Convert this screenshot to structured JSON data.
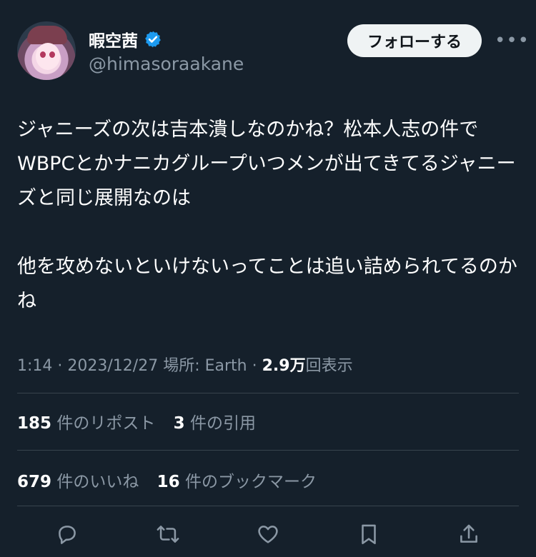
{
  "user": {
    "display_name": "暇空茜",
    "handle": "@himasoraakane",
    "verified": true
  },
  "header": {
    "follow_label": "フォローする",
    "more_label": "•••"
  },
  "tweet": {
    "text": "ジャニーズの次は吉本潰しなのかね？松本人志の件でWBPCとかナニカグループいつメンが出てきてるジャニーズと同じ展開なのは\n\n他を攻めないといけないってことは追い詰められてるのかね"
  },
  "meta": {
    "time": "1:14",
    "sep1": " · ",
    "date": "2023/12/27",
    "location": " 場所: Earth",
    "sep2": " · ",
    "views_count": "2.9万",
    "views_label": "回表示"
  },
  "stats": {
    "reposts_count": "185",
    "reposts_label": "件のリポスト",
    "quotes_count": "3",
    "quotes_label": "件の引用",
    "likes_count": "679",
    "likes_label": "件のいいね",
    "bookmarks_count": "16",
    "bookmarks_label": "件のブックマーク"
  },
  "actions": {
    "icons": [
      "reply-icon",
      "retweet-icon",
      "like-icon",
      "bookmark-icon",
      "share-icon"
    ]
  },
  "colors": {
    "background": "#15202b",
    "muted_text": "#8b98a5",
    "divider": "#38444d",
    "verified_blue": "#1d9bf0",
    "follow_button_bg": "#eff3f4"
  }
}
